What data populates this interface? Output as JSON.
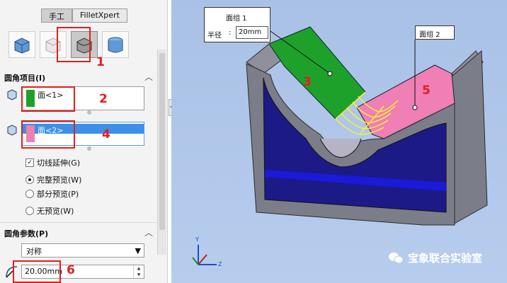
{
  "tabs": [
    "手工",
    "FilletXpert"
  ],
  "fillet_items": {
    "title": "圆角项目(I)",
    "faces": [
      "面<1>",
      "面<2>"
    ]
  },
  "options": {
    "tangent": "切线延伸(G)",
    "full_preview": "完整预览(W)",
    "partial_preview": "部分预览(P)",
    "no_preview": "无预览(W)"
  },
  "params": {
    "title": "圆角参数(P)",
    "symmetry": "对称",
    "radius_value": "20.00mm"
  },
  "markers": [
    "1",
    "2",
    "4",
    "6"
  ],
  "viewport": {
    "face_group_1": "面组 1",
    "radius_label": "半径",
    "radius_value": "20mm",
    "face_group_2": "面组 2",
    "marker_3": "3",
    "marker_5": "5"
  },
  "axes": {
    "y": "Y",
    "z": "Z"
  },
  "watermark": "宝象联合实验室",
  "colors": {
    "face1": "#1ea12b",
    "face2": "#ef7fb4",
    "accent_red": "#e0201c",
    "selection": "#3d8fe8",
    "part_gray": "#7b7d88",
    "part_blue": "#1c1a86"
  }
}
